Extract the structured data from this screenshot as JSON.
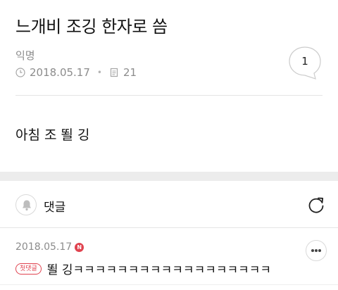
{
  "post": {
    "title": "느개비 조깅 한자로 씀",
    "author": "익명",
    "date": "2018.05.17",
    "views": "21",
    "comment_count": "1",
    "body": "아침 조 뙬 깅"
  },
  "comments_section": {
    "label": "댓글"
  },
  "comments": [
    {
      "date": "2018.05.17",
      "new_badge": "N",
      "first_badge": "첫댓글",
      "text": "뙬 깅ㅋㅋㅋㅋㅋㅋㅋㅋㅋㅋㅋㅋㅋㅋㅋㅋㅋㅋ"
    }
  ],
  "icons": {
    "date": "clock-icon",
    "views": "document-icon",
    "comment_count": "speech-bubble-icon",
    "notification": "bell-icon",
    "refresh": "refresh-icon",
    "more": "more-icon"
  },
  "colors": {
    "accent_red": "#e0434f",
    "muted_text": "#8c8c8c",
    "separator": "#ececec"
  }
}
